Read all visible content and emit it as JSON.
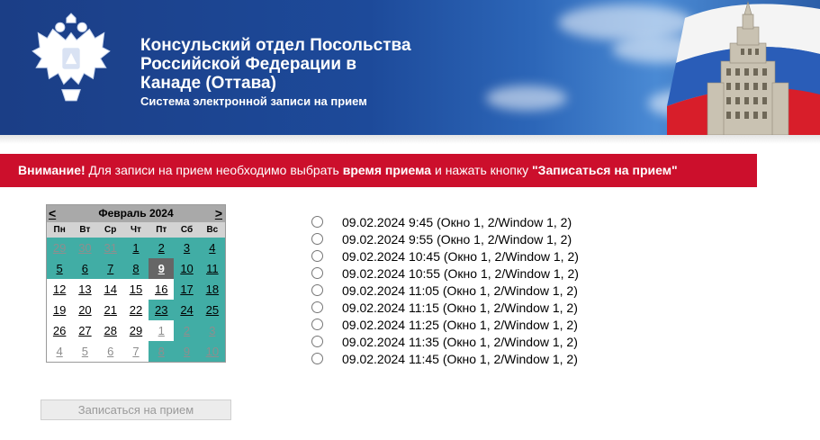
{
  "header": {
    "title_lines": [
      "Консульский отдел Посольства",
      "Российской Федерации в",
      "Канаде (Оттава)"
    ],
    "subtitle": "Система электронной записи на прием",
    "emblem_icon": "russian-coat-of-arms-icon",
    "flag_icon": "russian-flag-building-icon"
  },
  "notice": {
    "attention": "Внимание!",
    "text1": " Для записи на прием необходимо выбрать ",
    "bold1": "время приема",
    "text2": " и нажать кнопку ",
    "bold2": "\"Записаться на прием\""
  },
  "calendar": {
    "prev": "<",
    "next": ">",
    "month": "Февраль 2024",
    "weekdays": [
      "Пн",
      "Вт",
      "Ср",
      "Чт",
      "Пт",
      "Сб",
      "Вс"
    ],
    "weeks": [
      [
        "29",
        "30",
        "31",
        "1",
        "2",
        "3",
        "4"
      ],
      [
        "5",
        "6",
        "7",
        "8",
        "9",
        "10",
        "11"
      ],
      [
        "12",
        "13",
        "14",
        "15",
        "16",
        "17",
        "18"
      ],
      [
        "19",
        "20",
        "21",
        "22",
        "23",
        "24",
        "25"
      ],
      [
        "26",
        "27",
        "28",
        "29",
        "1",
        "2",
        "3"
      ],
      [
        "4",
        "5",
        "6",
        "7",
        "8",
        "9",
        "10"
      ]
    ],
    "selected_day": "9",
    "colors": {
      "teal": "#41ada5",
      "selected": "#666666",
      "header": "#a9a9a9"
    }
  },
  "slots": [
    "09.02.2024 9:45 (Окно 1, 2/Window 1, 2)",
    "09.02.2024 9:55 (Окно 1, 2/Window 1, 2)",
    "09.02.2024 10:45 (Окно 1, 2/Window 1, 2)",
    "09.02.2024 10:55 (Окно 1, 2/Window 1, 2)",
    "09.02.2024 11:05 (Окно 1, 2/Window 1, 2)",
    "09.02.2024 11:15 (Окно 1, 2/Window 1, 2)",
    "09.02.2024 11:25 (Окно 1, 2/Window 1, 2)",
    "09.02.2024 11:35 (Окно 1, 2/Window 1, 2)",
    "09.02.2024 11:45 (Окно 1, 2/Window 1, 2)"
  ],
  "submit_label": "Записаться на прием"
}
